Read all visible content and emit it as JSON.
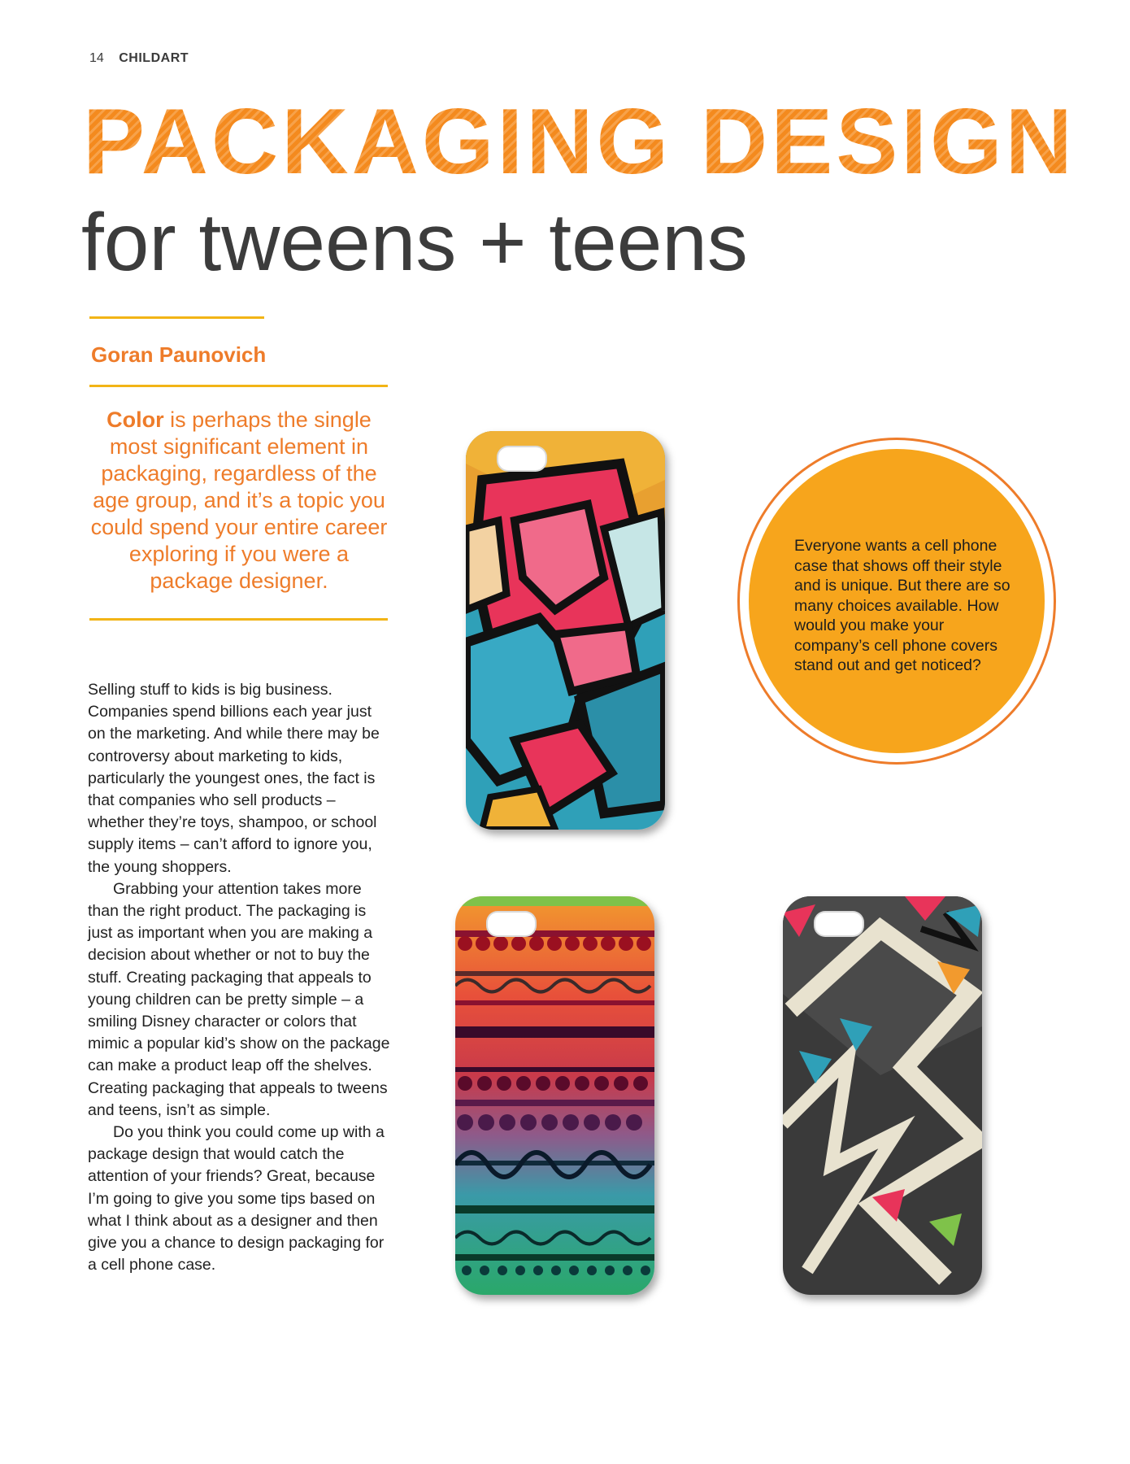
{
  "header": {
    "page_number": "14",
    "publication": "CHILDART"
  },
  "title": {
    "main": "PACKAGING DESIGN",
    "sub": "for tweens + teens"
  },
  "author": "Goran Paunovich",
  "pull_quote": {
    "lead": "Color",
    "rest": " is perhaps the single most significant element in packaging, regardless of the age group, and it’s a topic you could spend your entire career exploring if you were a package designer."
  },
  "body": {
    "paragraphs": [
      "Selling stuff to kids is big business. Companies spend billions each year just on the marketing.  And while there may be controversy about marketing to kids, particularly the youngest ones, the fact is that companies who sell products – whether they’re toys, shampoo, or school supply items – can’t afford to ignore you, the young shoppers.",
      "Grabbing your attention takes more than the right product. The packaging is just as important when you are making a decision about whether or not to buy the stuff. Creating packaging that appeals to young children can be pretty simple – a smiling Disney character or colors that mimic a popular kid’s show on the package can make a product leap off the shelves.  Creating packaging that appeals to tweens and teens, isn’t as simple.",
      "Do you think you could come up with a package design that would catch the attention of your friends? Great, because I’m going to give you some tips based on what I think about as a designer and then give you a chance to design packaging for a cell phone case."
    ]
  },
  "callout": "Everyone wants a cell phone case that shows off their style and is unique. But there are so many choices available. How would you make your company’s cell phone covers stand out and get noticed?",
  "colors": {
    "accent_orange": "#ee7c2a",
    "rule_yellow": "#f2b416",
    "bubble_fill": "#f7a51c"
  }
}
